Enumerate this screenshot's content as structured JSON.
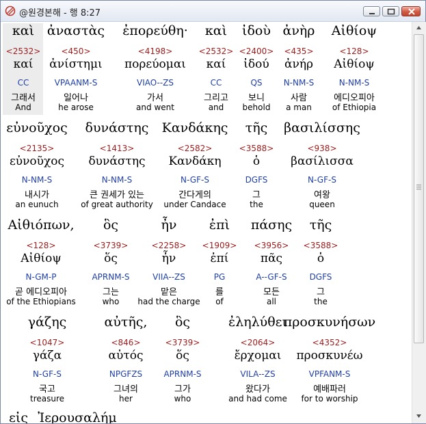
{
  "window": {
    "title": "@원경본해 - 행 8:27"
  },
  "colors": {
    "strong_number": "#9b1c1c",
    "morphology": "#1f3fa6",
    "text": "#000000",
    "selection": "#ececec"
  },
  "rows": [
    {
      "words": [
        {
          "greek": "καὶ",
          "strong": "<2532>",
          "lemma": "καί",
          "morph": "CC",
          "korean": "그래서",
          "english": "And"
        },
        {
          "greek": "ἀναστὰς",
          "strong": "<450>",
          "lemma": "ἀνίστημι",
          "morph": "VPAANM-S",
          "korean": "일어나",
          "english": "he arose"
        },
        {
          "greek": "ἐπορεύθη·",
          "strong": "<4198>",
          "lemma": "πορεύομαι",
          "morph": "VIAO--ZS",
          "korean": "가서",
          "english": "and went"
        },
        {
          "greek": "καὶ",
          "strong": "<2532>",
          "lemma": "καί",
          "morph": "CC",
          "korean": "그리고",
          "english": "and"
        },
        {
          "greek": "ἰδοὺ",
          "strong": "<2400>",
          "lemma": "ἰδού",
          "morph": "QS",
          "korean": "보니",
          "english": "behold"
        },
        {
          "greek": "ἀνὴρ",
          "strong": "<435>",
          "lemma": "ἀνήρ",
          "morph": "N-NM-S",
          "korean": "사람",
          "english": "a man"
        },
        {
          "greek": "Αἰθίοψ",
          "strong": "<128>",
          "lemma": "Αἰθίοψ",
          "morph": "N-NM-S",
          "korean": "에디오피아",
          "english": "of Ethiopia"
        }
      ]
    },
    {
      "words": [
        {
          "greek": "εὐνοῦχος",
          "strong": "<2135>",
          "lemma": "εὐνοῦχος",
          "morph": "N-NM-S",
          "korean": "내시가",
          "english": "an eunuch"
        },
        {
          "greek": "δυνάστης",
          "strong": "<1413>",
          "lemma": "δυνάστης",
          "morph": "N-NM-S",
          "korean": "큰 권세가 있는",
          "english": "of great authority"
        },
        {
          "greek": "Κανδάκης",
          "strong": "<2582>",
          "lemma": "Κανδάκη",
          "morph": "N-GF-S",
          "korean": "간다게의",
          "english": "under Candace"
        },
        {
          "greek": "τῆς",
          "strong": "<3588>",
          "lemma": "ὁ",
          "morph": "DGFS",
          "korean": "그",
          "english": "the"
        },
        {
          "greek": "βασιλίσσης",
          "strong": "<938>",
          "lemma": "βασίλισσα",
          "morph": "N-GF-S",
          "korean": "여왕",
          "english": "queen"
        }
      ]
    },
    {
      "words": [
        {
          "greek": "Αἰθιόπων,",
          "strong": "<128>",
          "lemma": "Αἰθίοψ",
          "morph": "N-GM-P",
          "korean": "곧 에디오피아",
          "english": "of the Ethiopians"
        },
        {
          "greek": "ὃς",
          "strong": "<3739>",
          "lemma": "ὅς",
          "morph": "APRNM-S",
          "korean": "그는",
          "english": "who"
        },
        {
          "greek": "ἦν",
          "strong": "<2258>",
          "lemma": "ἦν",
          "morph": "VIIA--ZS",
          "korean": "맡은",
          "english": "had the charge"
        },
        {
          "greek": "ἐπὶ",
          "strong": "<1909>",
          "lemma": "ἐπί",
          "morph": "PG",
          "korean": "를",
          "english": "of"
        },
        {
          "greek": "πάσης",
          "strong": "<3956>",
          "lemma": "πᾶς",
          "morph": "A--GF-S",
          "korean": "모든",
          "english": "all"
        },
        {
          "greek": "τῆς",
          "strong": "<3588>",
          "lemma": "ὁ",
          "morph": "DGFS",
          "korean": "그",
          "english": "the"
        }
      ]
    },
    {
      "words": [
        {
          "greek": "γάζης",
          "strong": "<1047>",
          "lemma": "γάζα",
          "morph": "N-GF-S",
          "korean": "국고",
          "english": "treasure"
        },
        {
          "greek": "αὐτῆς,",
          "strong": "<846>",
          "lemma": "αὐτός",
          "morph": "NPGFZS",
          "korean": "그녀의",
          "english": "her"
        },
        {
          "greek": "ὃς",
          "strong": "<3739>",
          "lemma": "ὅς",
          "morph": "APRNM-S",
          "korean": "그가",
          "english": "who"
        },
        {
          "greek": "ἐληλύθει",
          "strong": "<2064>",
          "lemma": "ἔρχομαι",
          "morph": "VILA--ZS",
          "korean": "왔다가",
          "english": "and had come"
        },
        {
          "greek": "προσκυνήσων",
          "strong": "<4352>",
          "lemma": "προσκυνέω",
          "morph": "VPFANM-S",
          "korean": "예배파러",
          "english": "for to worship"
        }
      ]
    },
    {
      "words": [
        {
          "greek": "εἰς"
        },
        {
          "greek": "Ἰερουσαλήμ"
        }
      ]
    }
  ]
}
